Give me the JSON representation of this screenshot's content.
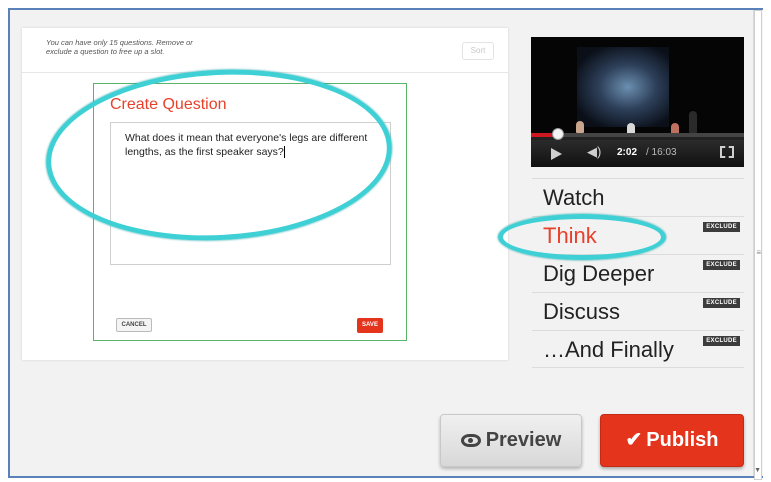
{
  "editor": {
    "note": "You can have only 15 questions. Remove or exclude a question to free up a slot.",
    "sort_label": "Sort",
    "create_title": "Create Question",
    "question_text": "What does it mean that everyone's legs are different lengths, as the first speaker says?",
    "cancel_label": "CANCEL",
    "save_label": "SAVE"
  },
  "video": {
    "current_time": "2:02",
    "total_time": "/ 16:03",
    "progress": 0.127
  },
  "nav": {
    "items": [
      {
        "label": "Watch",
        "badge": ""
      },
      {
        "label": "Think",
        "badge": "EXCLUDE"
      },
      {
        "label": "Dig Deeper",
        "badge": "EXCLUDE"
      },
      {
        "label": "Discuss",
        "badge": "EXCLUDE"
      },
      {
        "label": "…And Finally",
        "badge": "EXCLUDE"
      }
    ],
    "active_index": 1
  },
  "actions": {
    "preview_label": "Preview",
    "publish_label": "Publish"
  },
  "colors": {
    "accent_red": "#e5341c",
    "highlight_cyan": "#3ed0d4",
    "card_border_green": "#5bb36a"
  },
  "icons": {
    "preview": "eye-icon",
    "publish": "check-icon",
    "play": "play-icon",
    "volume": "volume-icon",
    "fullscreen": "fullscreen-icon"
  }
}
